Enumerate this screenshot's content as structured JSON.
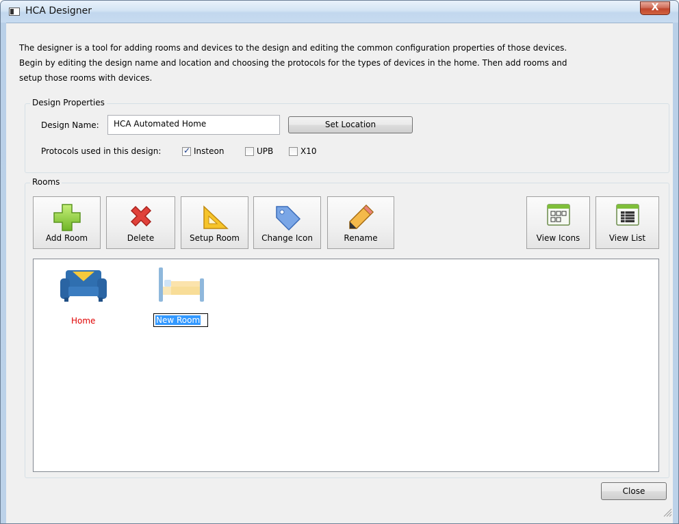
{
  "window": {
    "title": "HCA Designer",
    "close_glyph": "X"
  },
  "description": {
    "line1": "The designer is a tool for adding rooms and devices to the design and editing the common configuration properties of those devices.",
    "line2": "Begin by editing the design name and location and choosing the protocols for the types of devices in the home. Then add rooms and",
    "line3": "setup those rooms with devices."
  },
  "design_properties": {
    "group_title": "Design Properties",
    "name_label": "Design Name:",
    "name_value": "HCA Automated Home",
    "set_location_label": "Set Location",
    "protocols_label": "Protocols used in this design:",
    "protocols": [
      {
        "label": "Insteon",
        "checked": true
      },
      {
        "label": "UPB",
        "checked": false
      },
      {
        "label": "X10",
        "checked": false
      }
    ]
  },
  "rooms": {
    "group_title": "Rooms",
    "toolbar": {
      "add_room": "Add Room",
      "delete": "Delete",
      "setup_room": "Setup Room",
      "change_icon": "Change Icon",
      "rename": "Rename",
      "view_icons": "View Icons",
      "view_list": "View List"
    },
    "items": [
      {
        "label": "Home",
        "icon": "sofa-icon",
        "color": "#e00000"
      },
      {
        "label": "New Room",
        "icon": "bed-icon",
        "editing": true
      }
    ]
  },
  "footer": {
    "close_label": "Close"
  },
  "colors": {
    "selection": "#3399ff",
    "home_label": "#e00000",
    "close_button": "#c8462d"
  }
}
